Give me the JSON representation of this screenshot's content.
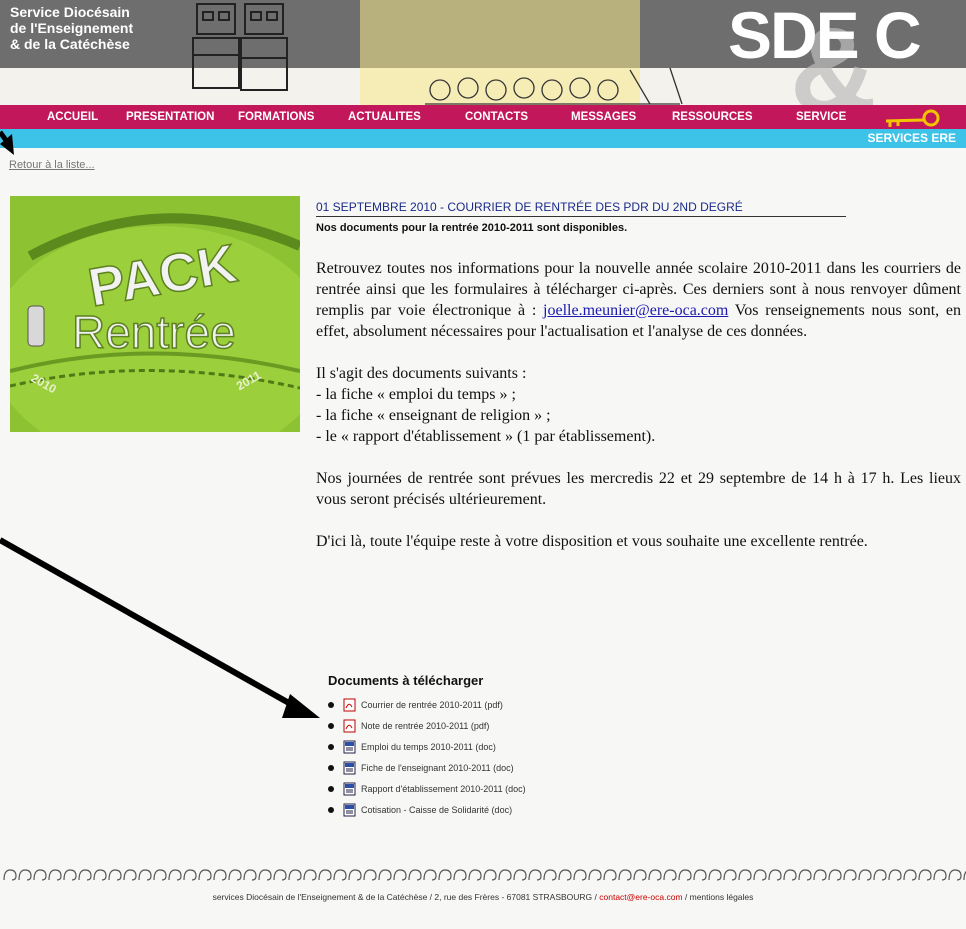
{
  "header": {
    "site_name": "Service Diocésain\nde l'Enseignement\n& de la Catéchèse",
    "logo": "SDE C"
  },
  "nav": {
    "items": [
      "ACCUEIL",
      "PRESENTATION",
      "FORMATIONS",
      "ACTUALITES",
      "CONTACTS",
      "MESSAGES",
      "RESSOURCES",
      "SERVICE"
    ]
  },
  "subbar": {
    "label": "SERVICES ERE"
  },
  "back_link": "Retour à la liste...",
  "image": {
    "text_pack": "PACK",
    "text_rentree": "Rentrée",
    "year_left": "2010",
    "year_right": "2011"
  },
  "article": {
    "title": "01 SEPTEMBRE 2010 - COURRIER DE RENTRÉE DES PDR DU 2ND DEGRÉ",
    "lead": "Nos documents pour la rentrée 2010-2011 sont disponibles.",
    "p1_before": "Retrouvez toutes nos informations pour la nouvelle année scolaire 2010-2011 dans les courriers de rentrée ainsi que les formulaires à télécharger ci-après. Ces derniers sont à nous renvoyer dûment remplis par voie électronique à : ",
    "p1_email": "joelle.meunier@ere-oca.com",
    "p1_after": " Vos renseignements nous sont, en effet, absolument nécessaires pour l'actualisation et l'analyse de ces données.",
    "p2_intro": "Il s'agit des documents suivants :",
    "p2_items": [
      "- la fiche « emploi du temps » ;",
      "- la fiche « enseignant de religion » ;",
      "- le « rapport d'établissement » (1 par établissement)."
    ],
    "p3": "Nos journées de rentrée sont prévues les mercredis 22 et 29 septembre de 14 h à 17 h. Les lieux vous seront précisés ultérieurement.",
    "p4": "D'ici là, toute l'équipe reste à votre disposition et vous souhaite une excellente rentrée."
  },
  "documents": {
    "heading": "Documents à télécharger",
    "items": [
      {
        "label": "Courrier de rentrée 2010-2011 (pdf)",
        "icon": "pdf-icon"
      },
      {
        "label": "Note de rentrée 2010-2011 (pdf)",
        "icon": "pdf-icon"
      },
      {
        "label": "Emploi du temps 2010-2011 (doc)",
        "icon": "word-icon"
      },
      {
        "label": "Fiche de l'enseignant 2010-2011 (doc)",
        "icon": "word-icon"
      },
      {
        "label": "Rapport d'établissement 2010-2011 (doc)",
        "icon": "word-icon"
      },
      {
        "label": "Cotisation - Caisse de Solidarité (doc)",
        "icon": "word-icon"
      }
    ]
  },
  "footer": {
    "text_before": "services Diocésain de l'Enseignement & de la Catéchèse / 2, rue des Frères - 67081 STRASBOURG / ",
    "email": "contact@ere-oca.com",
    "text_after": " / mentions légales"
  },
  "colors": {
    "nav": "#c2185b",
    "subbar": "#3ec3e8",
    "link": "#1a1ab0",
    "title": "#1a2a8a"
  }
}
